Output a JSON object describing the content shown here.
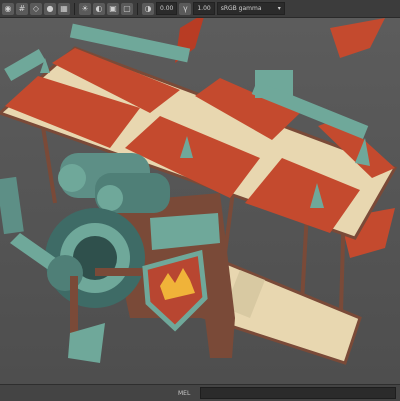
{
  "toolbar": {
    "value1": "0.00",
    "value2": "1.00",
    "colorspace": "sRGB gamma"
  },
  "commandline": {
    "language": "MEL"
  },
  "colors": {
    "wing_red": "#c44a2e",
    "wing_cream": "#e8d7b0",
    "metal_teal": "#6fa89a",
    "wood_brown": "#7a4a38",
    "engine_dark": "#3e6b66",
    "shield_red": "#b84631",
    "crown_gold": "#f0b339",
    "viewport_bg": "#555555"
  },
  "icons": [
    "camera-icon",
    "grid-icon",
    "wireframe-icon",
    "shaded-icon",
    "texture-icon",
    "light-icon",
    "shadow-icon",
    "xray-icon",
    "isolate-icon",
    "exposure-icon",
    "gamma-icon"
  ]
}
